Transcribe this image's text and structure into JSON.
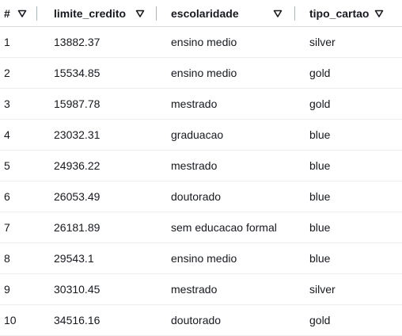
{
  "table": {
    "columns": [
      {
        "label": "#",
        "sort_icon": "sort-descending-outline-icon"
      },
      {
        "label": "limite_credito",
        "sort_icon": "sort-descending-outline-icon"
      },
      {
        "label": "escolaridade",
        "sort_icon": "sort-descending-outline-icon"
      },
      {
        "label": "tipo_cartao",
        "sort_icon": "sort-descending-outline-icon"
      }
    ],
    "rows": [
      [
        "1",
        "13882.37",
        "ensino medio",
        "silver"
      ],
      [
        "2",
        "15534.85",
        "ensino medio",
        "gold"
      ],
      [
        "3",
        "15987.78",
        "mestrado",
        "gold"
      ],
      [
        "4",
        "23032.31",
        "graduacao",
        "blue"
      ],
      [
        "5",
        "24936.22",
        "mestrado",
        "blue"
      ],
      [
        "6",
        "26053.49",
        "doutorado",
        "blue"
      ],
      [
        "7",
        "26181.89",
        "sem educacao formal",
        "blue"
      ],
      [
        "8",
        "29543.1",
        "ensino medio",
        "blue"
      ],
      [
        "9",
        "30310.45",
        "mestrado",
        "silver"
      ],
      [
        "10",
        "34516.16",
        "doutorado",
        "gold"
      ]
    ]
  },
  "colors": {
    "text": "#16191f",
    "divider": "#aab7b8",
    "row_border": "#eaeded"
  }
}
